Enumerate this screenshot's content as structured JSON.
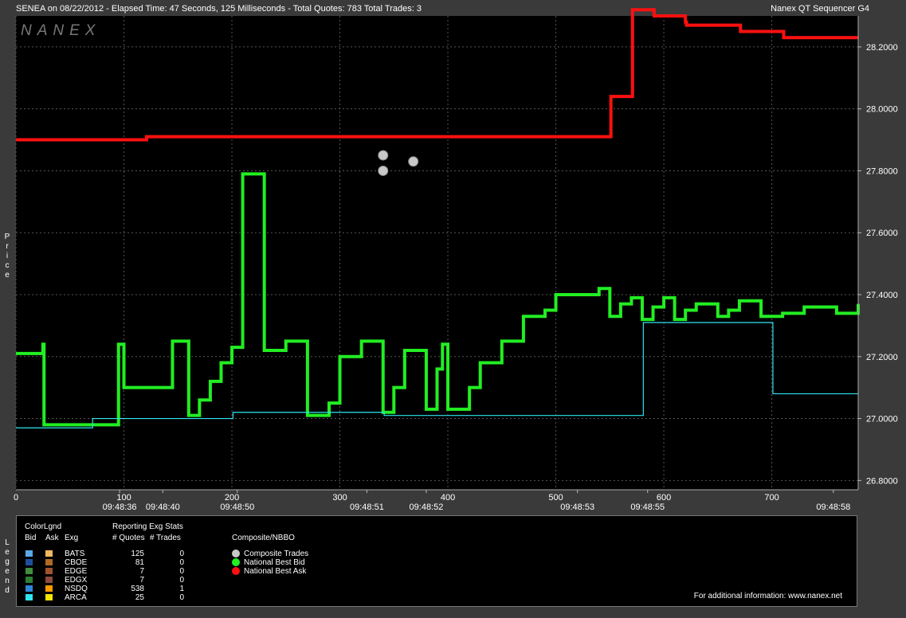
{
  "header": {
    "left": "SENEA on 08/22/2012  -  Elapsed Time: 47 Seconds, 125 Milliseconds  -  Total Quotes: 783  Total Trades: 3",
    "right": "Nanex QT Sequencer G4",
    "watermark": "NANEX"
  },
  "axis": {
    "ylabel": "Price",
    "yticks": [
      "28.2000",
      "28.0000",
      "27.8000",
      "27.6000",
      "27.4000",
      "27.2000",
      "27.0000",
      "26.8000"
    ],
    "xticks": [
      "0",
      "100",
      "200",
      "300",
      "400",
      "500",
      "600",
      "700"
    ],
    "times": [
      "09:48:36",
      "09:48:40",
      "09:48:50",
      "09:48:51",
      "09:48:52",
      "09:48:53",
      "09:48:55",
      "09:48:58"
    ]
  },
  "legend": {
    "side_label": "Legend",
    "colorlgnd": "ColorLgnd",
    "bid_h": "Bid",
    "ask_h": "Ask",
    "exg_h": "Exg",
    "stats_title": "Reporting Exg Stats",
    "quotes_h": "# Quotes",
    "trades_h": "# Trades",
    "composite_title": "Composite/NBBO",
    "rows": [
      {
        "exg": "BATS",
        "quotes": "125",
        "trades": "0",
        "bid_color": "#5aa9e6",
        "ask_color": "#f0b860"
      },
      {
        "exg": "CBOE",
        "quotes": "81",
        "trades": "0",
        "bid_color": "#1f4e9a",
        "ask_color": "#b06a20"
      },
      {
        "exg": "EDGE",
        "quotes": "7",
        "trades": "0",
        "bid_color": "#3e8f3e",
        "ask_color": "#a0522d"
      },
      {
        "exg": "EDGX",
        "quotes": "7",
        "trades": "0",
        "bid_color": "#2e7d32",
        "ask_color": "#8b4a3a"
      },
      {
        "exg": "NSDQ",
        "quotes": "538",
        "trades": "1",
        "bid_color": "#2f86d6",
        "ask_color": "#ff9a00"
      },
      {
        "exg": "ARCA",
        "quotes": "25",
        "trades": "0",
        "bid_color": "#2ee6f0",
        "ask_color": "#f5e600"
      }
    ],
    "composite": [
      {
        "label": "Composite Trades",
        "color": "#c8c8c8"
      },
      {
        "label": "National Best Bid",
        "color": "#22ee22"
      },
      {
        "label": "National Best Ask",
        "color": "#ff1010"
      }
    ],
    "footer": "For additional information: www.nanex.net"
  },
  "chart_data": {
    "type": "line",
    "ylim": [
      26.77,
      28.3
    ],
    "xlim": [
      0,
      780
    ],
    "ylabel": "Price",
    "grid": true,
    "series": [
      {
        "name": "National Best Ask",
        "color": "#ff1010",
        "x": [
          0,
          120,
          121,
          550,
          551,
          570,
          571,
          590,
          591,
          620,
          621,
          670,
          671,
          710,
          711,
          780
        ],
        "y": [
          27.9,
          27.9,
          27.91,
          27.91,
          28.04,
          28.04,
          28.32,
          28.32,
          28.3,
          28.28,
          28.27,
          28.27,
          28.25,
          28.25,
          28.23,
          28.23
        ]
      },
      {
        "name": "National Best Bid",
        "color": "#22ee22",
        "x": [
          0,
          25,
          26,
          95,
          100,
          130,
          145,
          160,
          170,
          180,
          190,
          200,
          210,
          230,
          250,
          270,
          290,
          300,
          320,
          340,
          350,
          360,
          380,
          390,
          395,
          400,
          420,
          430,
          450,
          470,
          475,
          480,
          490,
          500,
          540,
          550,
          560,
          570,
          580,
          590,
          600,
          610,
          620,
          630,
          650,
          660,
          670,
          690,
          710,
          730,
          760,
          780
        ],
        "y": [
          27.21,
          27.24,
          26.98,
          27.24,
          27.1,
          27.1,
          27.25,
          27.01,
          27.06,
          27.12,
          27.18,
          27.23,
          27.79,
          27.22,
          27.25,
          27.01,
          27.05,
          27.2,
          27.25,
          27.02,
          27.1,
          27.22,
          27.03,
          27.16,
          27.24,
          27.03,
          27.1,
          27.18,
          27.25,
          27.33,
          27.33,
          27.33,
          27.35,
          27.4,
          27.42,
          27.33,
          27.37,
          27.39,
          27.32,
          27.36,
          27.39,
          27.32,
          27.35,
          27.37,
          27.33,
          27.35,
          27.38,
          27.33,
          27.34,
          27.36,
          27.34,
          27.37
        ]
      },
      {
        "name": "ARCA",
        "color": "#2ee6f0",
        "x": [
          0,
          70,
          71,
          200,
          201,
          340,
          341,
          580,
          581,
          700,
          701,
          780
        ],
        "y": [
          26.97,
          26.97,
          27.0,
          27.0,
          27.02,
          27.02,
          27.01,
          27.01,
          27.31,
          27.31,
          27.08,
          27.08
        ]
      }
    ],
    "trades": [
      {
        "x": 340,
        "y": 27.85
      },
      {
        "x": 340,
        "y": 27.8
      },
      {
        "x": 368,
        "y": 27.83
      }
    ]
  }
}
